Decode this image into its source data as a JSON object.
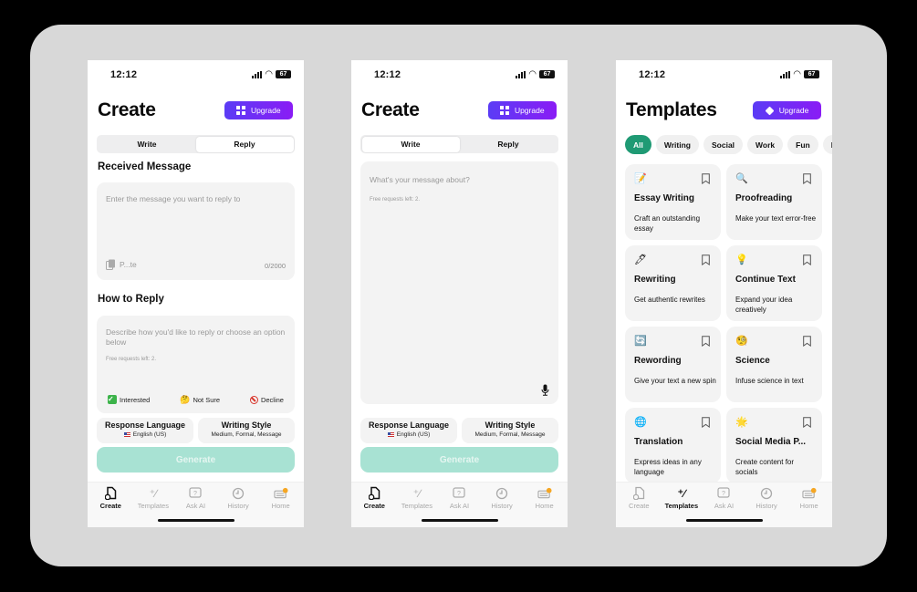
{
  "status": {
    "time": "12:12",
    "battery": "67"
  },
  "screens": [
    {
      "title": "Create",
      "upgrade_label": "Upgrade",
      "segments": [
        "Write",
        "Reply"
      ],
      "active_segment": "Reply",
      "received": {
        "heading": "Received Message",
        "placeholder": "Enter the message you want to reply to",
        "paste_label": "P...te",
        "counter": "0/2000"
      },
      "how": {
        "heading": "How to Reply",
        "placeholder": "Describe how you'd like to reply or choose an option below",
        "free_requests": "Free requests left: 2.",
        "options": [
          {
            "icon": "check-mark-icon",
            "label": "Interested"
          },
          {
            "icon": "thinking-face-icon",
            "label": "Not Sure"
          },
          {
            "icon": "prohibited-icon",
            "label": "Decline"
          }
        ]
      },
      "language": {
        "label": "Response Language",
        "value": "English (US)"
      },
      "style": {
        "label": "Writing Style",
        "value": "Medium, Formal, Message"
      },
      "generate_label": "Generate"
    },
    {
      "title": "Create",
      "upgrade_label": "Upgrade",
      "segments": [
        "Write",
        "Reply"
      ],
      "active_segment": "Write",
      "message": {
        "placeholder": "What's your message about?",
        "free_requests": "Free requests left: 2."
      },
      "language": {
        "label": "Response Language",
        "value": "English (US)"
      },
      "style": {
        "label": "Writing Style",
        "value": "Medium, Formal, Message"
      },
      "generate_label": "Generate"
    },
    {
      "title": "Templates",
      "upgrade_label": "Upgrade",
      "chips": [
        "All",
        "Writing",
        "Social",
        "Work",
        "Fun",
        "M"
      ],
      "active_chip": "All",
      "cards": [
        {
          "icon": "📝",
          "icon_name": "memo-icon",
          "title": "Essay Writing",
          "desc": "Craft an outstanding essay"
        },
        {
          "icon": "🔍",
          "icon_name": "magnifier-icon",
          "title": "Proofreading",
          "desc": "Make your text error-free"
        },
        {
          "icon": "🖊",
          "icon_name": "pen-icon",
          "title": "Rewriting",
          "desc": "Get authentic rewrites"
        },
        {
          "icon": "💡",
          "icon_name": "lightbulb-icon",
          "title": "Continue Text",
          "desc": "Expand your idea creatively"
        },
        {
          "icon": "🔄",
          "icon_name": "refresh-icon",
          "title": "Rewording",
          "desc": "Give your text a new spin"
        },
        {
          "icon": "🧐",
          "icon_name": "monocle-face-icon",
          "title": "Science",
          "desc": "Infuse science in text"
        },
        {
          "icon": "🌐",
          "icon_name": "globe-icon",
          "title": "Translation",
          "desc": "Express ideas in any language"
        },
        {
          "icon": "🌟",
          "icon_name": "star-icon",
          "title": "Social Media P...",
          "desc": "Create content for socials"
        }
      ]
    }
  ],
  "tabbar": {
    "items": [
      "Create",
      "Templates",
      "Ask AI",
      "History",
      "Home"
    ]
  },
  "colors": {
    "accent_green": "#1f9a74",
    "upgrade_start": "#5b3cf5",
    "upgrade_end": "#8a1cf5",
    "generate_disabled": "#a8e2d3"
  }
}
